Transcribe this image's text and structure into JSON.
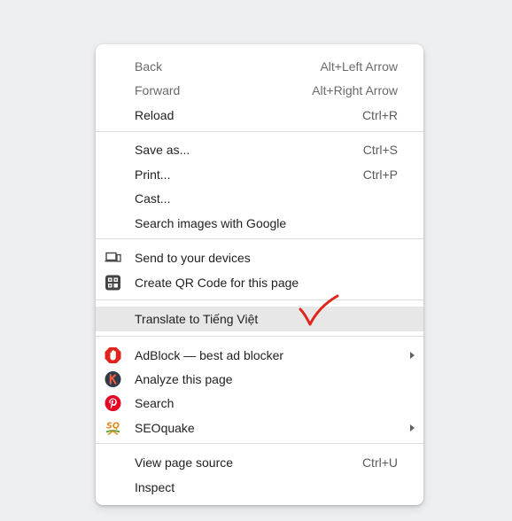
{
  "menu": {
    "items": [
      {
        "label": "Back",
        "shortcut": "Alt+Left Arrow"
      },
      {
        "label": "Forward",
        "shortcut": "Alt+Right Arrow"
      },
      {
        "label": "Reload",
        "shortcut": "Ctrl+R"
      },
      {
        "label": "Save as...",
        "shortcut": "Ctrl+S"
      },
      {
        "label": "Print...",
        "shortcut": "Ctrl+P"
      },
      {
        "label": "Cast..."
      },
      {
        "label": "Search images with Google"
      },
      {
        "label": "Send to your devices",
        "icon": "devices-icon"
      },
      {
        "label": "Create QR Code for this page",
        "icon": "qr-code-icon"
      },
      {
        "label": "Translate to Tiếng Việt"
      },
      {
        "label": "AdBlock — best ad blocker",
        "icon": "adblock-hand-icon",
        "submenu": true
      },
      {
        "label": "Analyze this page",
        "icon": "k-logo-icon"
      },
      {
        "label": "Search",
        "icon": "pinterest-icon"
      },
      {
        "label": "SEOquake",
        "icon": "seoquake-icon",
        "submenu": true
      },
      {
        "label": "View page source",
        "shortcut": "Ctrl+U"
      },
      {
        "label": "Inspect"
      }
    ]
  },
  "colors": {
    "background": "#eeeff1",
    "menu_bg": "#ffffff",
    "highlight": "#e7e7e7",
    "annotation_check": "#e0241c",
    "adblock_red": "#e0241c",
    "pinterest_red": "#e60023",
    "seoquake_orange": "#e08a1e"
  }
}
